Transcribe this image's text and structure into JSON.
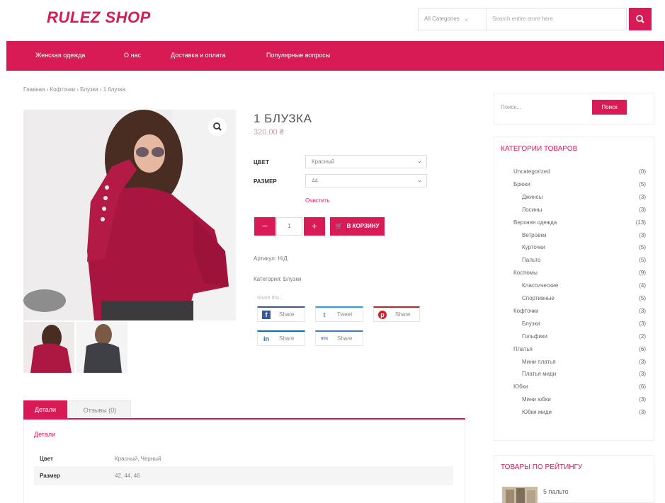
{
  "header": {
    "logo": "RULEZ SHOP",
    "search_category": "All Categories",
    "search_placeholder": "Search entire store here"
  },
  "nav": {
    "items": [
      "Женская одежда",
      "О нас",
      "Доставка и оплата",
      "Популярные вопросы"
    ]
  },
  "breadcrumb": "Главная › Кофточки › Блузки › 1 блузка",
  "product": {
    "title": "1 БЛУЗКА",
    "price": "320,00 ₴",
    "attributes": [
      {
        "label": "ЦВЕТ",
        "value": "Красный"
      },
      {
        "label": "РАЗМЕР",
        "value": "44"
      }
    ],
    "clear_label": "Очистить",
    "qty_minus": "−",
    "qty_value": "1",
    "qty_plus": "+",
    "cart_label": "В КОРЗИНУ",
    "sku": "Артикул: Н/Д",
    "category": "Категория: Блузки",
    "share_label": "Share this...",
    "share_buttons": [
      {
        "icon": "f",
        "label": "Share"
      },
      {
        "icon": "t",
        "label": "Tweet"
      },
      {
        "icon": "p",
        "label": "Share"
      },
      {
        "icon": "in",
        "label": "Share"
      },
      {
        "icon": "mix",
        "label": "Share"
      }
    ]
  },
  "tabs": {
    "items": [
      "Детали",
      "Отзывы (0)"
    ],
    "active": 0,
    "panel_title": "Детали",
    "specs": [
      {
        "key": "Цвет",
        "value": "Красный, Черный"
      },
      {
        "key": "Размер",
        "value": "42, 44, 46"
      }
    ]
  },
  "sidebar": {
    "search_placeholder": "Поиск...",
    "search_button": "Поиск",
    "categories_title": "КАТЕГОРИИ ТОВАРОВ",
    "categories": [
      {
        "name": "Uncategorized",
        "count": "(0)",
        "level": 0
      },
      {
        "name": "Брюки",
        "count": "(5)",
        "level": 0
      },
      {
        "name": "Джинсы",
        "count": "(3)",
        "level": 1
      },
      {
        "name": "Лосины",
        "count": "(3)",
        "level": 1
      },
      {
        "name": "Верхняя одежда",
        "count": "(13)",
        "level": 0
      },
      {
        "name": "Ветровки",
        "count": "(3)",
        "level": 1
      },
      {
        "name": "Курточки",
        "count": "(5)",
        "level": 1
      },
      {
        "name": "Пальто",
        "count": "(5)",
        "level": 1
      },
      {
        "name": "Костюмы",
        "count": "(9)",
        "level": 0
      },
      {
        "name": "Классические",
        "count": "(4)",
        "level": 1
      },
      {
        "name": "Спортивные",
        "count": "(5)",
        "level": 1
      },
      {
        "name": "Кофточки",
        "count": "(3)",
        "level": 0
      },
      {
        "name": "Блузки",
        "count": "(3)",
        "level": 1
      },
      {
        "name": "Гольфики",
        "count": "(2)",
        "level": 1
      },
      {
        "name": "Платья",
        "count": "(6)",
        "level": 0
      },
      {
        "name": "Мини платья",
        "count": "(3)",
        "level": 1
      },
      {
        "name": "Платья миди",
        "count": "(3)",
        "level": 1
      },
      {
        "name": "Юбки",
        "count": "(6)",
        "level": 0
      },
      {
        "name": "Мини юбки",
        "count": "(3)",
        "level": 1
      },
      {
        "name": "Юбки миди",
        "count": "(3)",
        "level": 1
      }
    ],
    "rated_title": "ТОВАРЫ ПО РЕЙТИНГУ",
    "rated_first": "5 пальто"
  },
  "colors": {
    "accent": "#d81b55"
  }
}
